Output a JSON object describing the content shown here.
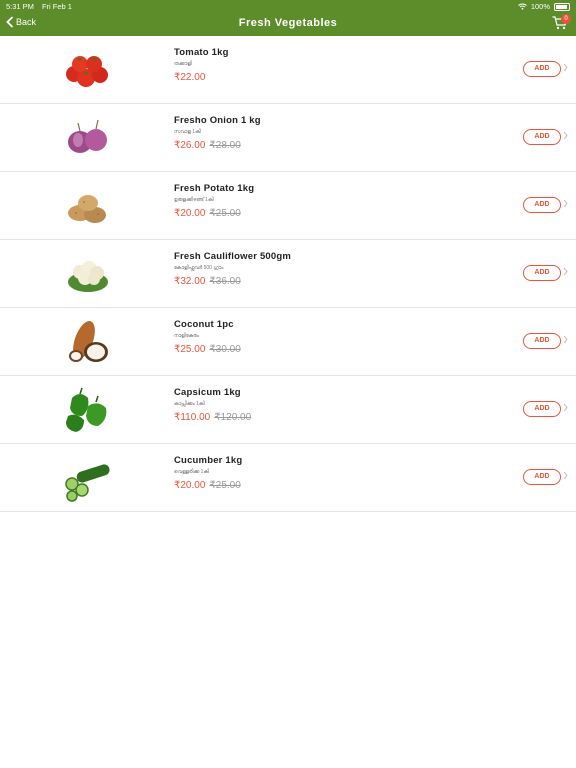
{
  "status_bar": {
    "time": "5:31 PM",
    "date": "Fri Feb 1",
    "battery": "100%"
  },
  "header": {
    "back_label": "Back",
    "title": "Fresh Vegetables",
    "cart_count": "0"
  },
  "products": [
    {
      "name": "Tomato 1kg",
      "local_name": "തക്കാളി",
      "price": "₹22.00",
      "mrp": "",
      "add_label": "ADD",
      "image": "tomato"
    },
    {
      "name": "Fresho Onion 1 kg",
      "local_name": "സവാള 1കി",
      "price": "₹26.00",
      "mrp": "₹28.00",
      "add_label": "ADD",
      "image": "onion"
    },
    {
      "name": "Fresh Potato 1kg",
      "local_name": "ഉരുളക്കിഴങ്ങ് 1കി",
      "price": "₹20.00",
      "mrp": "₹25.00",
      "add_label": "ADD",
      "image": "potato"
    },
    {
      "name": "Fresh Cauliflower 500gm",
      "local_name": "കോളിഫ്ലവർ 500 ഗ്രാം",
      "price": "₹32.00",
      "mrp": "₹36.00",
      "add_label": "ADD",
      "image": "cauliflower"
    },
    {
      "name": "Coconut 1pc",
      "local_name": "നാളികേരം",
      "price": "₹25.00",
      "mrp": "₹30.00",
      "add_label": "ADD",
      "image": "coconut"
    },
    {
      "name": "Capsicum 1kg",
      "local_name": "കാപ്സിക്കം 1കി",
      "price": "₹110.00",
      "mrp": "₹120.00",
      "add_label": "ADD",
      "image": "capsicum"
    },
    {
      "name": "Cucumber 1kg",
      "local_name": "വെള്ളരിക്ക 1കി",
      "price": "₹20.00",
      "mrp": "₹25.00",
      "add_label": "ADD",
      "image": "cucumber"
    }
  ],
  "colors": {
    "header": "#5d8c2a",
    "accent": "#e8553a"
  }
}
